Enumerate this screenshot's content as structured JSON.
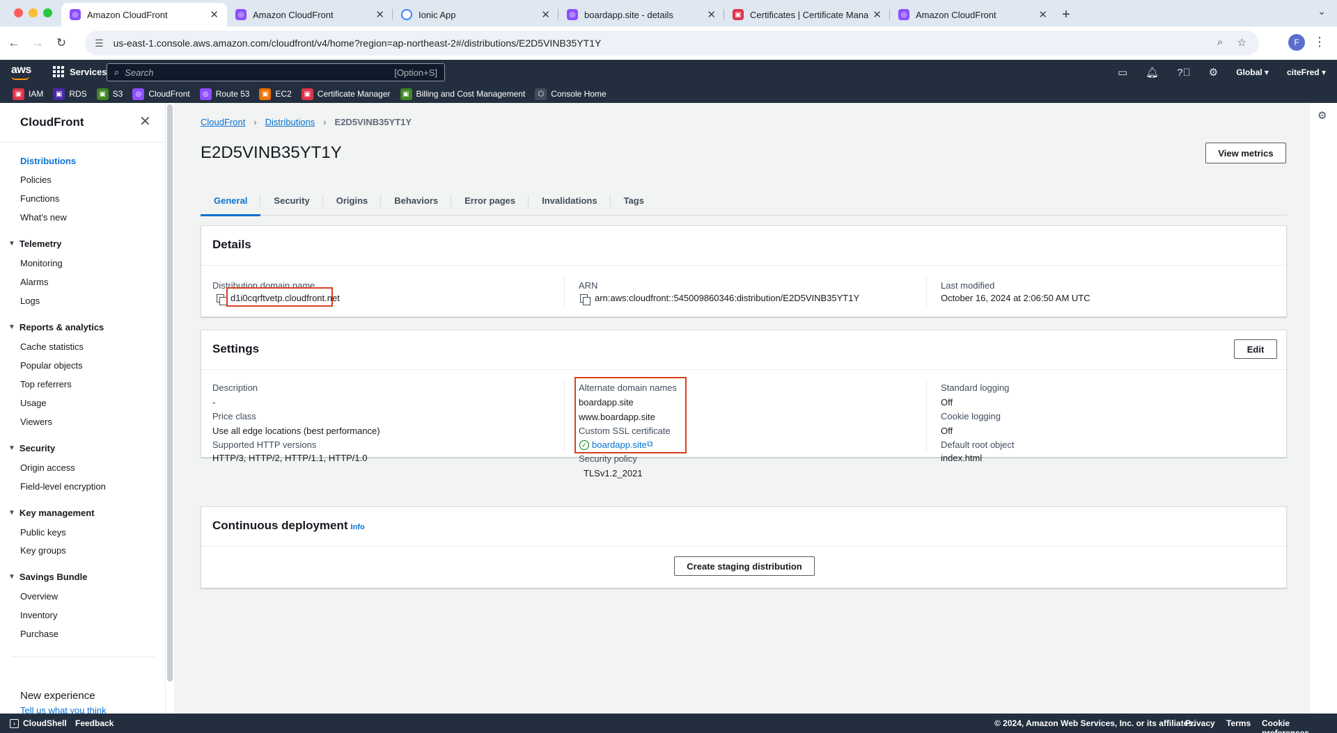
{
  "browser": {
    "tabs": [
      {
        "title": "Amazon CloudFront",
        "favicon": "cloudfront-icon",
        "active": true
      },
      {
        "title": "Amazon CloudFront",
        "favicon": "cloudfront-icon",
        "active": false
      },
      {
        "title": "Ionic App",
        "favicon": "ionic-icon",
        "active": false
      },
      {
        "title": "boardapp.site - details",
        "favicon": "cloudfront-icon",
        "active": false
      },
      {
        "title": "Certificates | Certificate Mana",
        "favicon": "certificate-manager-icon",
        "active": false
      },
      {
        "title": "Amazon CloudFront",
        "favicon": "cloudfront-icon",
        "active": false
      }
    ],
    "url": "us-east-1.console.aws.amazon.com/cloudfront/v4/home?region=ap-northeast-2#/distributions/E2D5VINB35YT1Y",
    "profile_initial": "F"
  },
  "aws_header": {
    "logo": "aws",
    "services_label": "Services",
    "search_placeholder": "Search",
    "search_shortcut": "[Option+S]",
    "region": "Global",
    "account": "citeFred",
    "favorites": [
      {
        "label": "IAM",
        "color": "#dd344c"
      },
      {
        "label": "RDS",
        "color": "#4d27aa"
      },
      {
        "label": "S3",
        "color": "#3f8624"
      },
      {
        "label": "CloudFront",
        "color": "#8c4fff"
      },
      {
        "label": "Route 53",
        "color": "#8c4fff"
      },
      {
        "label": "EC2",
        "color": "#ed7100"
      },
      {
        "label": "Certificate Manager",
        "color": "#dd344c"
      },
      {
        "label": "Billing and Cost Management",
        "color": "#3f8624"
      },
      {
        "label": "Console Home",
        "color": "#232f3e"
      }
    ]
  },
  "sidebar": {
    "title": "CloudFront",
    "top_items": [
      "Distributions",
      "Policies",
      "Functions",
      "What's new"
    ],
    "sections": [
      {
        "title": "Telemetry",
        "items": [
          "Monitoring",
          "Alarms",
          "Logs"
        ]
      },
      {
        "title": "Reports & analytics",
        "items": [
          "Cache statistics",
          "Popular objects",
          "Top referrers",
          "Usage",
          "Viewers"
        ]
      },
      {
        "title": "Security",
        "items": [
          "Origin access",
          "Field-level encryption"
        ]
      },
      {
        "title": "Key management",
        "items": [
          "Public keys",
          "Key groups"
        ]
      },
      {
        "title": "Savings Bundle",
        "items": [
          "Overview",
          "Inventory",
          "Purchase"
        ]
      }
    ],
    "new_experience": "New experience",
    "feedback_link": "Tell us what you think"
  },
  "breadcrumb": {
    "items": [
      "CloudFront",
      "Distributions"
    ],
    "current": "E2D5VINB35YT1Y"
  },
  "page": {
    "title": "E2D5VINB35YT1Y",
    "view_metrics": "View metrics",
    "tabs": [
      "General",
      "Security",
      "Origins",
      "Behaviors",
      "Error pages",
      "Invalidations",
      "Tags"
    ]
  },
  "details": {
    "title": "Details",
    "domain_label": "Distribution domain name",
    "domain_value": "d1i0cqrftvetp.cloudfront.net",
    "arn_label": "ARN",
    "arn_value": "arn:aws:cloudfront::545009860346:distribution/E2D5VINB35YT1Y",
    "modified_label": "Last modified",
    "modified_value": "October 16, 2024 at 2:06:50 AM UTC"
  },
  "settings": {
    "title": "Settings",
    "edit_label": "Edit",
    "description_label": "Description",
    "description_value": "-",
    "price_label": "Price class",
    "price_value": "Use all edge locations (best performance)",
    "http_label": "Supported HTTP versions",
    "http_value": "HTTP/3, HTTP/2, HTTP/1.1, HTTP/1.0",
    "alt_label": "Alternate domain names",
    "alt_values": [
      "boardapp.site",
      "www.boardapp.site"
    ],
    "ssl_label": "Custom SSL certificate",
    "ssl_value": "boardapp.site",
    "policy_label": "Security policy",
    "policy_value": "TLSv1.2_2021",
    "logging_label": "Standard logging",
    "logging_value": "Off",
    "cookie_label": "Cookie logging",
    "cookie_value": "Off",
    "root_label": "Default root object",
    "root_value": "index.html"
  },
  "continuous": {
    "title": "Continuous deployment",
    "info": "Info",
    "button": "Create staging distribution"
  },
  "footer": {
    "cloudshell": "CloudShell",
    "feedback": "Feedback",
    "copyright": "© 2024, Amazon Web Services, Inc. or its affiliates.",
    "links": [
      "Privacy",
      "Terms",
      "Cookie preferences"
    ]
  }
}
